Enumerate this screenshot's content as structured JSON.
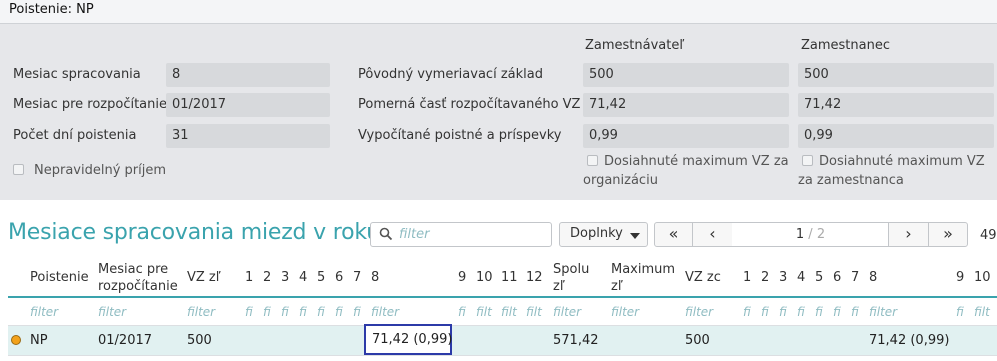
{
  "panel": {
    "title": "Poistenie: NP",
    "employer_header": "Zamestnávateľ",
    "employee_header": "Zamestnanec",
    "left_rows": [
      {
        "label": "Mesiac spracovania",
        "value": "8"
      },
      {
        "label": "Mesiac pre rozpočítanie",
        "value": "01/2017"
      },
      {
        "label": "Počet dní poistenia",
        "value": "31"
      }
    ],
    "irregular_income_label": "Nepravidelný príjem",
    "right_rows": [
      {
        "label": "Pôvodný vymeriavací základ",
        "employer": "500",
        "employee": "500"
      },
      {
        "label": "Pomerná časť rozpočítavaného VZ",
        "employer": "71,42",
        "employee": "71,42"
      },
      {
        "label": "Vypočítané poistné a príspevky",
        "employer": "0,99",
        "employee": "0,99"
      }
    ],
    "max_org_label": "Dosiahnuté maximum VZ za organizáciu",
    "max_emp_label": "Dosiahnuté maximum VZ za zamestnanca"
  },
  "section": {
    "title": "Mesiace spracovania miezd v roku",
    "search_placeholder": "filter",
    "addons_label": "Doplnky",
    "pager_first": "«",
    "pager_prev": "‹",
    "pager_current": "1",
    "pager_sep_total": " / 2",
    "pager_next": "›",
    "pager_last": "»",
    "count": "49"
  },
  "table": {
    "headers": {
      "poistenie": "Poistenie",
      "mesiac": "Mesiac pre rozpočítanie",
      "vz": "VZ zľ",
      "m1": "1",
      "m2": "2",
      "m3": "3",
      "m4": "4",
      "m5": "5",
      "m6": "6",
      "m7": "7",
      "m8": "8",
      "m9": "9",
      "m10": "10",
      "m11": "11",
      "m12": "12",
      "spolu": "Spolu zľ",
      "maximum": "Maximum zľ",
      "vzzc": "VZ zc",
      "z1": "1",
      "z2": "2",
      "z3": "3",
      "z4": "4",
      "z5": "5",
      "z6": "6",
      "z7": "7",
      "z8": "8",
      "z9": "9",
      "z10": "10"
    },
    "filters": {
      "full": "filter",
      "short": "fi",
      "medium": "filt"
    },
    "row": {
      "poistenie": "NP",
      "mesiac": "01/2017",
      "vz": "500",
      "m8": "71,42 (0,99)",
      "spolu": "571,42",
      "vzzc": "500",
      "z8": "71,42 (0,99)"
    },
    "colors": {
      "accent": "#3aa3ad",
      "row_bg": "#e1f1f1",
      "highlight_border": "#2c3aa8",
      "status_dot": "#f3a21b"
    }
  }
}
